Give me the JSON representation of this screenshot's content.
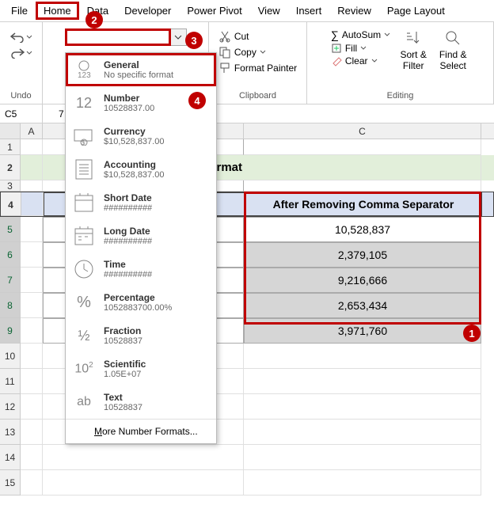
{
  "menubar": [
    "File",
    "Home",
    "Data",
    "Developer",
    "Power Pivot",
    "View",
    "Insert",
    "Review",
    "Page Layout"
  ],
  "ribbon": {
    "undo": "Undo",
    "clipboard": {
      "label": "Clipboard",
      "cut": "Cut",
      "copy": "Copy",
      "fmt": "Format Painter"
    },
    "editing": {
      "label": "Editing",
      "autosum": "AutoSum",
      "fill": "Fill",
      "clear": "Clear",
      "sort": "Sort & Filter",
      "find": "Find & Select"
    }
  },
  "namebox": "C5",
  "formula": "7",
  "sheet": {
    "title_partial": "ing General Format",
    "header_b": "",
    "header_c": "After Removing Comma Separator",
    "values_c": [
      "10,528,837",
      "2,379,105",
      "9,216,666",
      "2,653,434",
      "3,971,760"
    ]
  },
  "dropdown": {
    "items": [
      {
        "t": "General",
        "s": "No specific format"
      },
      {
        "t": "Number",
        "s": "10528837.00"
      },
      {
        "t": "Currency",
        "s": "$10,528,837.00"
      },
      {
        "t": "Accounting",
        "s": "$10,528,837.00"
      },
      {
        "t": "Short Date",
        "s": "##########"
      },
      {
        "t": "Long Date",
        "s": "##########"
      },
      {
        "t": "Time",
        "s": "##########"
      },
      {
        "t": "Percentage",
        "s": "1052883700.00%"
      },
      {
        "t": "Fraction",
        "s": "10528837"
      },
      {
        "t": "Scientific",
        "s": "1.05E+07"
      },
      {
        "t": "Text",
        "s": "10528837"
      }
    ],
    "more": "More Number Formats..."
  },
  "callouts": {
    "1": "1",
    "2": "2",
    "3": "3",
    "4": "4"
  }
}
